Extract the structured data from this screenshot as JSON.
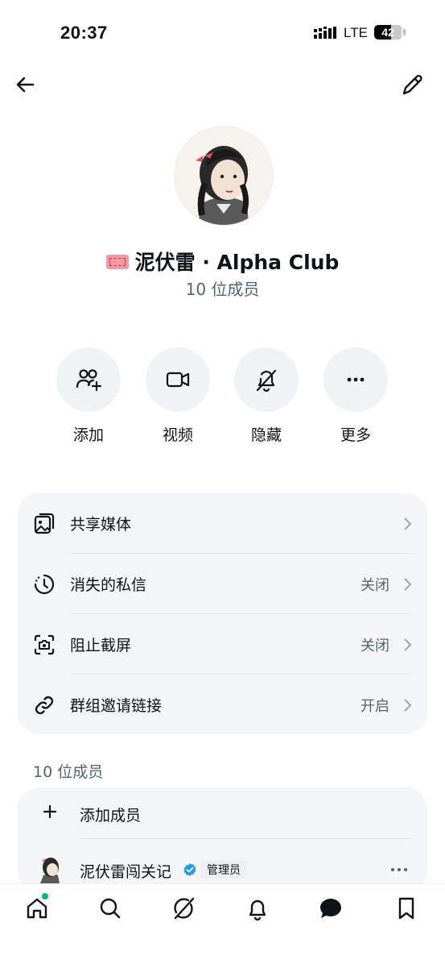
{
  "status_bar": {
    "time": "20:37",
    "network": "LTE",
    "battery": "42"
  },
  "group": {
    "name": "泥伏雷 · Alpha Club",
    "member_count": "10 位成员"
  },
  "actions": [
    {
      "label": "添加",
      "icon": "add-user-icon"
    },
    {
      "label": "视频",
      "icon": "video-icon"
    },
    {
      "label": "隐藏",
      "icon": "bell-slash-icon"
    },
    {
      "label": "更多",
      "icon": "more-icon"
    }
  ],
  "settings": [
    {
      "label": "共享媒体",
      "value": "",
      "icon": "media-icon"
    },
    {
      "label": "消失的私信",
      "value": "关闭",
      "icon": "timer-icon"
    },
    {
      "label": "阻止截屏",
      "value": "关闭",
      "icon": "screenshot-icon"
    },
    {
      "label": "群组邀请链接",
      "value": "开启",
      "icon": "link-icon"
    }
  ],
  "members_section": {
    "heading": "10 位成员",
    "add_label": "添加成员",
    "members": [
      {
        "name": "泥伏雷闯关记",
        "badge": "管理员",
        "verified": true
      }
    ]
  },
  "tabbar": [
    "home-icon",
    "search-icon",
    "grok-icon",
    "bell-icon",
    "messages-icon",
    "bookmark-icon"
  ],
  "colors": {
    "accent": "#1d9bf0",
    "online": "#00ba7c",
    "secondary_text": "#536471",
    "card_bg": "#f4f5f7"
  }
}
